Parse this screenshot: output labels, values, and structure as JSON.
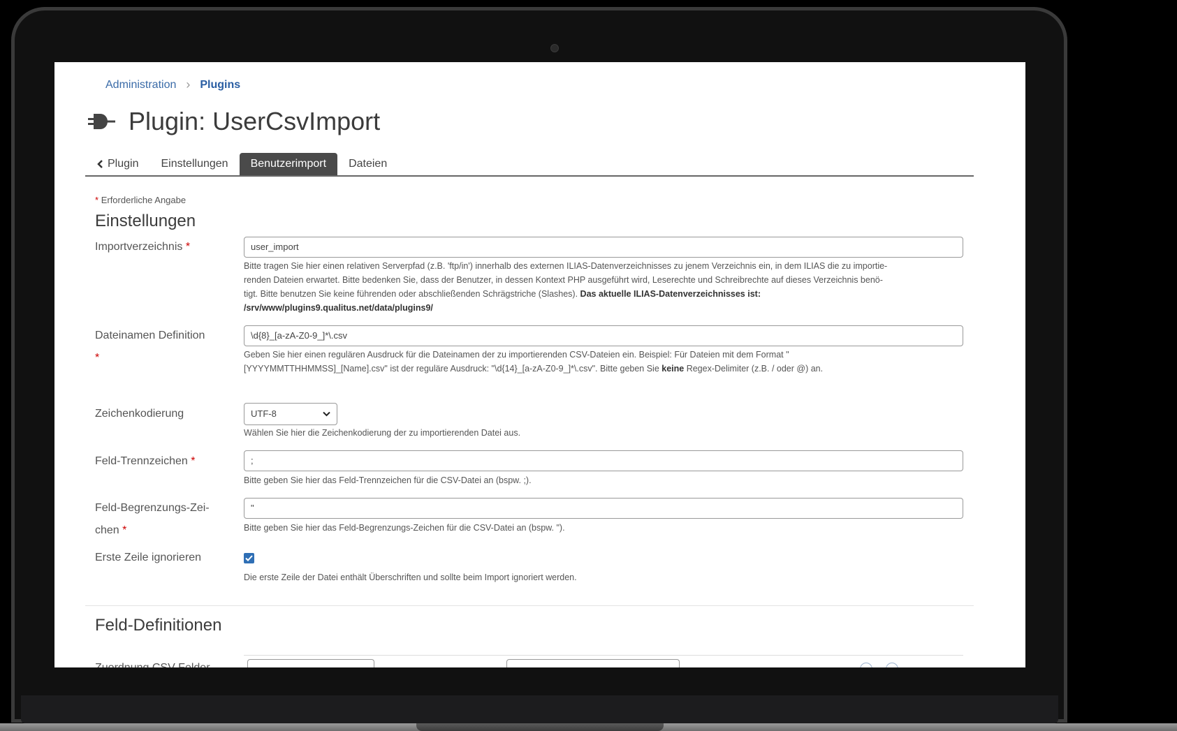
{
  "breadcrumb": {
    "parent": "Administration",
    "current": "Plugins"
  },
  "page": {
    "title": "Plugin: UserCsvImport",
    "icon": "plug-icon"
  },
  "tabs": [
    {
      "label": "Plugin",
      "icon": "chevron-left-icon"
    },
    {
      "label": "Einstellungen"
    },
    {
      "label": "Benutzerimport",
      "active": true
    },
    {
      "label": "Dateien"
    }
  ],
  "required_note": "Erforderliche Angabe",
  "required_marker": "*",
  "section_settings": "Einstellungen",
  "fields": {
    "import_dir": {
      "label": "Importverzeichnis",
      "value": "user_import",
      "help_lines": [
        "Bitte tragen Sie hier einen relativen Serverpfad (z.B. 'ftp/in') innerhalb des externen ILIAS-Datenverzeichnisses zu jenem Verzeichnis ein, in dem ILIAS die zu importie-",
        "renden Dateien erwartet. Bitte bedenken Sie, dass der Benutzer, in dessen Kontext PHP ausgeführt wird, Leserechte und Schreibrechte auf dieses Verzeichnis benö-",
        "tigt. Bitte benutzen Sie keine führenden oder abschließenden Schrägstriche (Slashes). "
      ],
      "help_bold_1": "Das aktuelle ILIAS-Datenverzeichnisses ist:",
      "help_bold_2": "/srv/www/plugins9.qualitus.net/data/plugins9/"
    },
    "filename_def": {
      "label": "Dateinamen Definition",
      "value": "\\d{8}_[a-zA-Z0-9_]*\\.csv",
      "help_line1": "Geben Sie hier einen regulären Ausdruck für die Dateinamen der zu importierenden CSV-Dateien ein. Beispiel: Für Dateien mit dem Format \"",
      "help_line2_pre": "[YYYYMMTTHHMMSS]_[Name].csv\" ist der reguläre Ausdruck: \"\\d{14}_[a-zA-Z0-9_]*\\.csv\". Bitte geben Sie ",
      "help_line2_bold": "keine",
      "help_line2_post": " Regex-Delimiter (z.B. / oder @) an."
    },
    "encoding": {
      "label": "Zeichenkodierung",
      "value": "UTF-8",
      "help": "Wählen Sie hier die Zeichenkodierung der zu importierenden Datei aus."
    },
    "separator": {
      "label": "Feld-Trennzeichen",
      "value": ";",
      "help": "Bitte geben Sie hier das Feld-Trennzeichen für die CSV-Datei an (bspw. ;)."
    },
    "delimiter": {
      "label_line1": "Feld-Begrenzungs-Zei-",
      "label_line2": "chen",
      "value": "\"",
      "help": "Bitte geben Sie hier das Feld-Begrenzungs-Zeichen für die CSV-Datei an (bspw. \")."
    },
    "skip_first": {
      "label": "Erste Zeile ignorieren",
      "checked": true,
      "help": "Die erste Zeile der Datei enthält Überschriften und sollte beim Import ignoriert werden."
    }
  },
  "section_fields": "Feld-Definitionen",
  "mapping_label": "Zuordnung CSV-Felder"
}
